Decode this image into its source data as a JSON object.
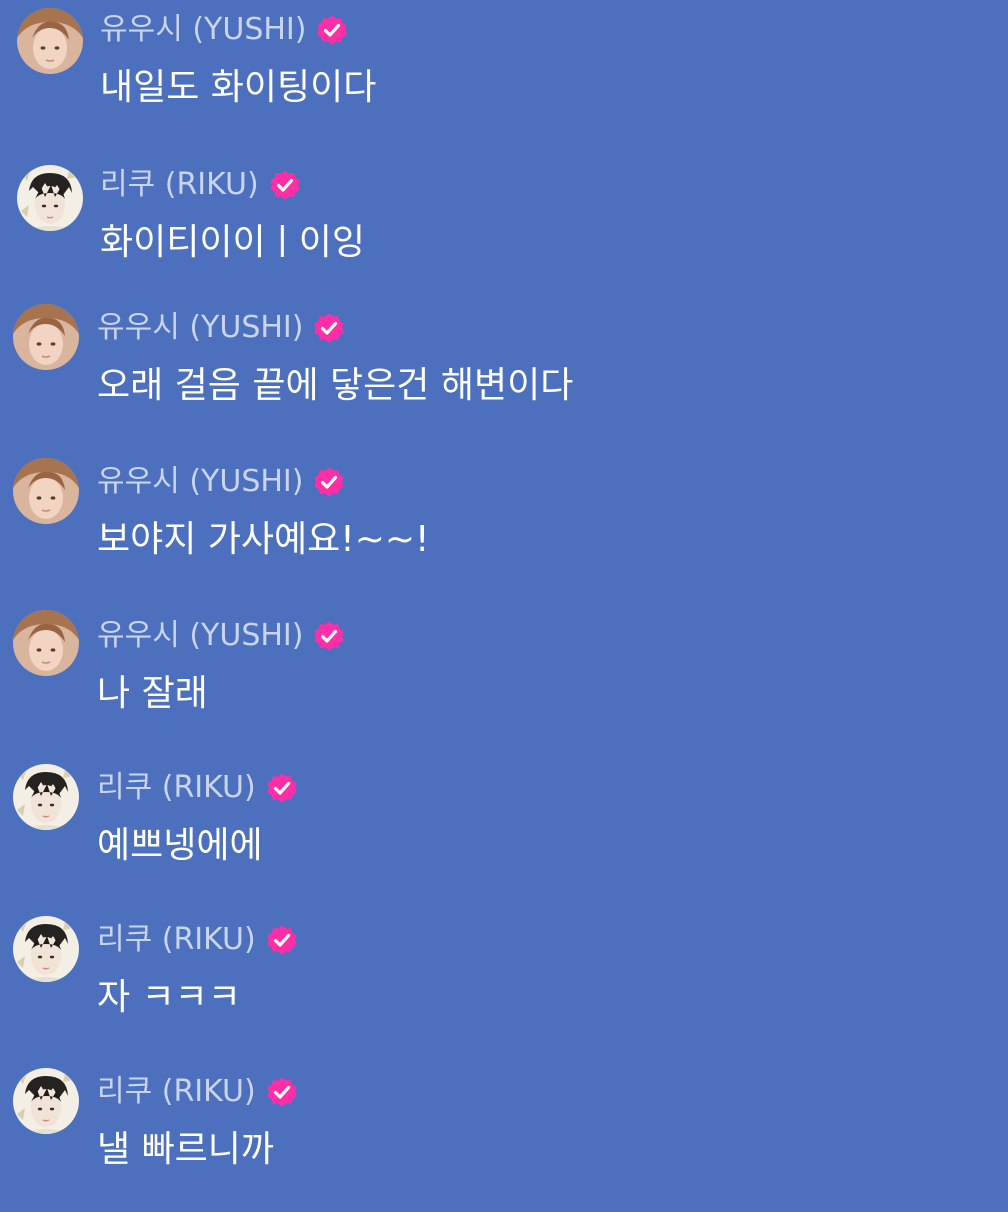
{
  "colors": {
    "background": "#4c70bd",
    "name_text": "#c9d4ee",
    "message_text": "#ffffff",
    "verified_badge": "#ff2ea6"
  },
  "messages": [
    {
      "author": "유우시 (YUSHI)",
      "verified_icon": "verified-check-icon",
      "avatar": "yushi-avatar",
      "text": "내일도 화이팅이다"
    },
    {
      "author": "리쿠 (RIKU)",
      "verified_icon": "verified-check-icon",
      "avatar": "riku-avatar",
      "text": "화이티이이ㅣ이잉"
    },
    {
      "author": "유우시 (YUSHI)",
      "verified_icon": "verified-check-icon",
      "avatar": "yushi-avatar",
      "text": "오래 걸음 끝에 닿은건 해변이다"
    },
    {
      "author": "유우시 (YUSHI)",
      "verified_icon": "verified-check-icon",
      "avatar": "yushi-avatar",
      "text": "보야지 가사예요!~~!"
    },
    {
      "author": "유우시 (YUSHI)",
      "verified_icon": "verified-check-icon",
      "avatar": "yushi-avatar",
      "text": "나 잘래"
    },
    {
      "author": "리쿠 (RIKU)",
      "verified_icon": "verified-check-icon",
      "avatar": "riku-avatar",
      "text": "예쁘넹에에"
    },
    {
      "author": "리쿠 (RIKU)",
      "verified_icon": "verified-check-icon",
      "avatar": "riku-avatar",
      "text": "자 ㅋㅋㅋ"
    },
    {
      "author": "리쿠 (RIKU)",
      "verified_icon": "verified-check-icon",
      "avatar": "riku-avatar",
      "text": "낼 빠르니까"
    }
  ]
}
